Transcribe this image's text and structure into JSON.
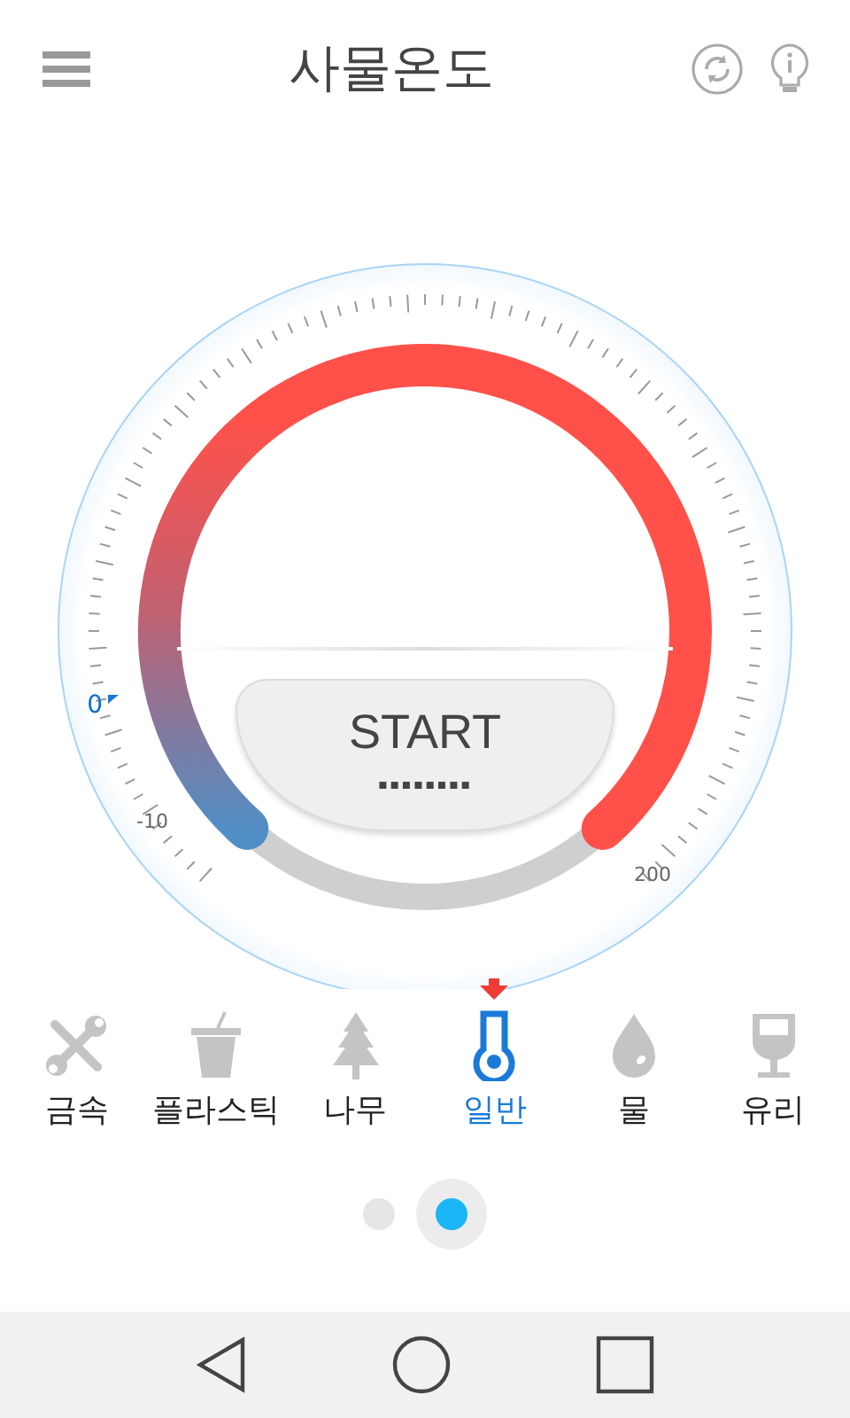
{
  "header": {
    "title": "사물온도"
  },
  "gauge": {
    "scale_labels": [
      {
        "label": "0",
        "marked": true
      },
      {
        "label": "-10",
        "marked": false
      },
      {
        "label": "200",
        "marked": false
      }
    ],
    "start_button": {
      "label": "START",
      "reading": "▪▪▪▪▪▪▪▪"
    }
  },
  "materials": [
    {
      "label": "금속",
      "selected": false
    },
    {
      "label": "플라스틱",
      "selected": false
    },
    {
      "label": "나무",
      "selected": false
    },
    {
      "label": "일반",
      "selected": true
    },
    {
      "label": "물",
      "selected": false
    },
    {
      "label": "유리",
      "selected": false
    }
  ],
  "pager": [
    {
      "selected": false
    },
    {
      "selected": true
    }
  ]
}
